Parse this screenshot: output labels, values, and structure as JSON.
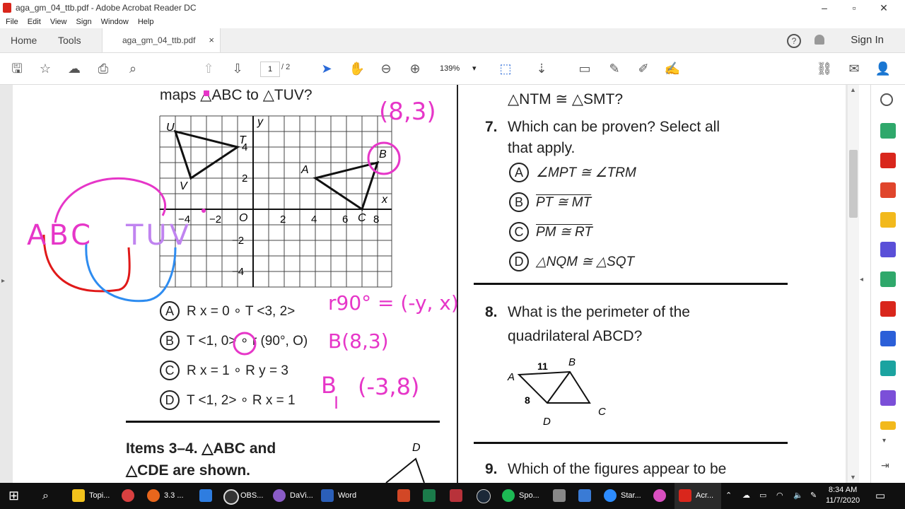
{
  "window": {
    "title": "aga_gm_04_ttb.pdf - Adobe Acrobat Reader DC"
  },
  "menu": [
    "File",
    "Edit",
    "View",
    "Sign",
    "Window",
    "Help"
  ],
  "tabs": {
    "home": "Home",
    "tools": "Tools",
    "doc": "aga_gm_04_ttb.pdf",
    "close": "×"
  },
  "header": {
    "help": "?",
    "sign_in": "Sign In"
  },
  "toolbar": {
    "page": "1",
    "total": "/ 2",
    "zoom": "139%"
  },
  "left_col": {
    "top_text": "maps △ABC to △TUV?",
    "grid_labels": {
      "U": "U",
      "T": "T",
      "V": "V",
      "A": "A",
      "B": "B",
      "C": "C",
      "x": "x",
      "y": "y",
      "O": "O"
    },
    "x_ticks": [
      "−4",
      "−2",
      "2",
      "4",
      "6",
      "8"
    ],
    "y_ticks": [
      "4",
      "2",
      "−2",
      "−4"
    ],
    "options": [
      {
        "letter": "A",
        "text": "R x = 0 ∘ T <3, 2>"
      },
      {
        "letter": "B",
        "text": "T <1, 0> ∘ r (90°, O)"
      },
      {
        "letter": "C",
        "text": "R x = 1 ∘ R y = 3"
      },
      {
        "letter": "D",
        "text": "T <1, 2> ∘ R x = 1"
      }
    ],
    "items_line1": "Items 3–4. △ABC and",
    "items_line2": "△CDE are shown.",
    "d_label": "D"
  },
  "right_col": {
    "top_text": "△NTM ≅ △SMT?",
    "q7_num": "7.",
    "q7_line1": "Which can be proven? Select all",
    "q7_line2": "that apply.",
    "q7_options": [
      {
        "letter": "A",
        "text": "∠MPT ≅ ∠TRM"
      },
      {
        "letter": "B",
        "text": "PT ≅ MT"
      },
      {
        "letter": "C",
        "text": "PM ≅ RT"
      },
      {
        "letter": "D",
        "text": "△NQM ≅ △SQT"
      }
    ],
    "q8_num": "8.",
    "q8_line1": "What is the perimeter of the",
    "q8_line2": "quadrilateral ABCD?",
    "fig": {
      "A": "A",
      "B": "B",
      "C": "C",
      "D": "D",
      "side_ab": "11",
      "side_ad": "8"
    },
    "q9_num": "9.",
    "q9_line1": "Which of the figures appear to be"
  },
  "handwriting": {
    "n1": "(8,3)",
    "abc": "ABC",
    "tuv": "TUV",
    "r90": "r90° = (-y, x)",
    "b83": "B(8,3)",
    "bp": "B",
    "i": "I",
    "m38": "(-3,8)"
  },
  "taskbar": {
    "items": [
      "Topi...",
      "3.3 ...",
      "OBS...",
      "DaVi...",
      "Word",
      "Spo...",
      "Star...",
      "Acr..."
    ],
    "time": "8:34 AM",
    "date": "11/7/2020"
  }
}
